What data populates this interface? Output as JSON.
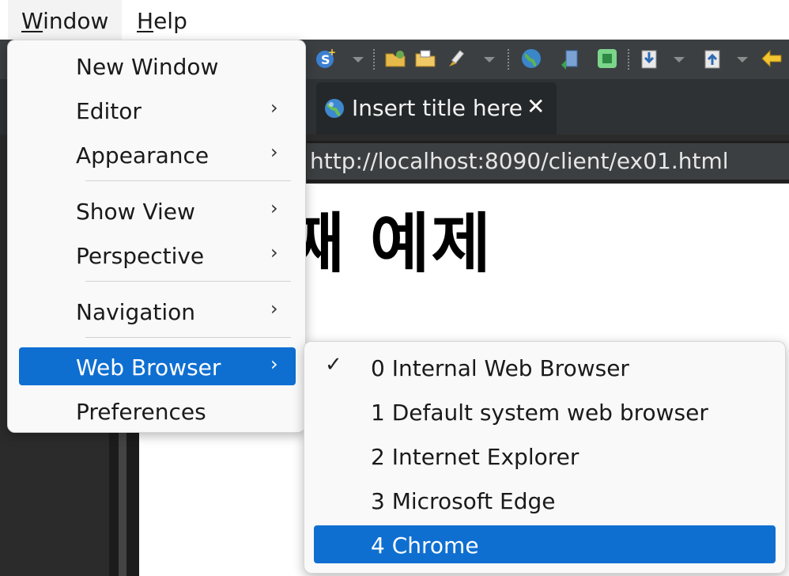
{
  "menubar": {
    "items": [
      {
        "mnemonic": "W",
        "rest": "indow"
      },
      {
        "mnemonic": "H",
        "rest": "elp"
      }
    ]
  },
  "browser_tab": {
    "title": "Insert title here",
    "close_glyph": "✕",
    "icon": "globe-icon"
  },
  "address_bar": {
    "url": "http://localhost:8090/client/ex01.html"
  },
  "page": {
    "heading": "째 예제"
  },
  "window_menu": {
    "items": [
      {
        "label": "New Window"
      },
      {
        "label": "Editor",
        "arrow": "›"
      },
      {
        "label": "Appearance",
        "arrow": "›"
      },
      {
        "label": "Show View",
        "arrow": "›"
      },
      {
        "label": "Perspective",
        "arrow": "›"
      },
      {
        "label": "Navigation",
        "arrow": "›"
      },
      {
        "label": "Web Browser",
        "arrow": "›"
      },
      {
        "label": "Preferences"
      }
    ],
    "selected_item": "Web Browser"
  },
  "web_browser_submenu": {
    "checked_glyph": "✓",
    "items": [
      {
        "label": "0 Internal Web Browser"
      },
      {
        "label": "1 Default system web browser"
      },
      {
        "label": "2 Internet Explorer"
      },
      {
        "label": "3 Microsoft Edge"
      },
      {
        "label": "4 Chrome"
      }
    ],
    "checked_item": "0 Internal Web Browser",
    "selected_item": "4 Chrome"
  },
  "colors": {
    "selection": "#0f6fd1",
    "menu_bg": "#f9f9f9",
    "toolbar_bg": "#3b3f42"
  }
}
